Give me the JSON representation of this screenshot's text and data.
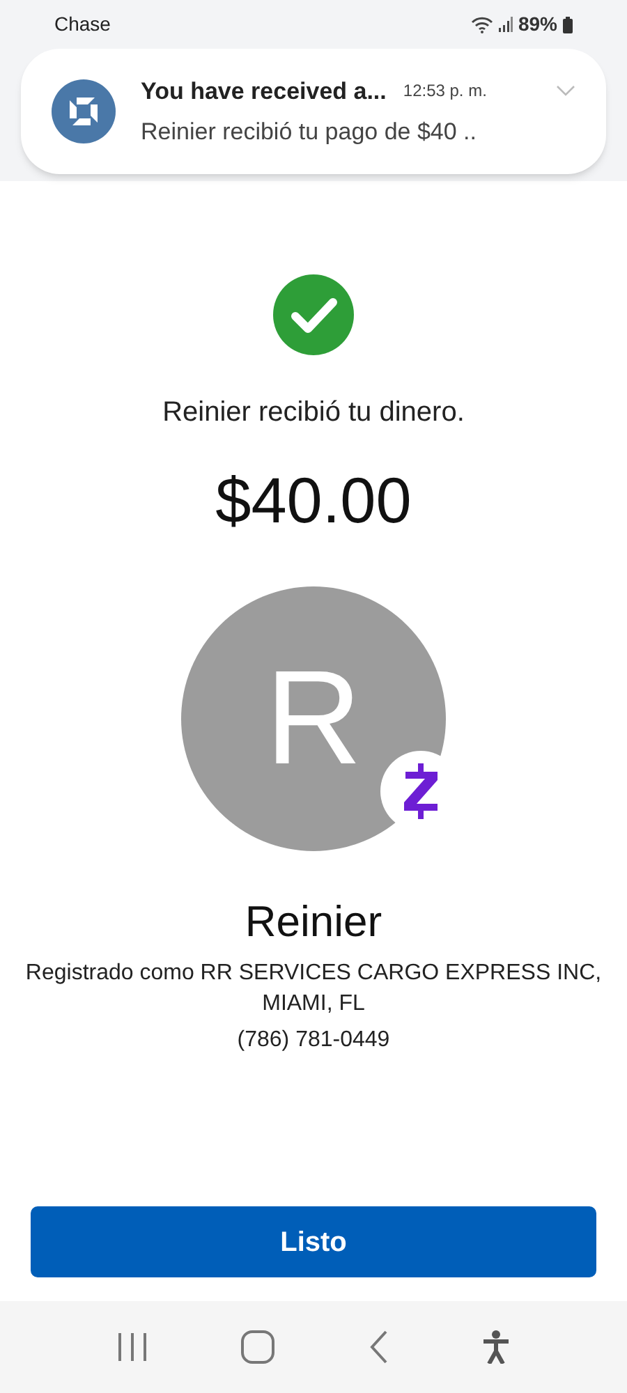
{
  "status_bar": {
    "app": "Chase",
    "battery": "89%"
  },
  "notification": {
    "title": "You have received a...",
    "time": "12:53 p. m.",
    "body": "Reinier recibió tu pago de $40 .."
  },
  "confirmation": {
    "message": "Reinier recibió tu dinero.",
    "amount": "$40.00"
  },
  "recipient": {
    "initial": "R",
    "name": "Reinier",
    "registered": "Registrado como RR SERVICES CARGO EXPRESS INC, MIAMI, FL",
    "phone": "(786) 781-0449"
  },
  "done_button": "Listo"
}
